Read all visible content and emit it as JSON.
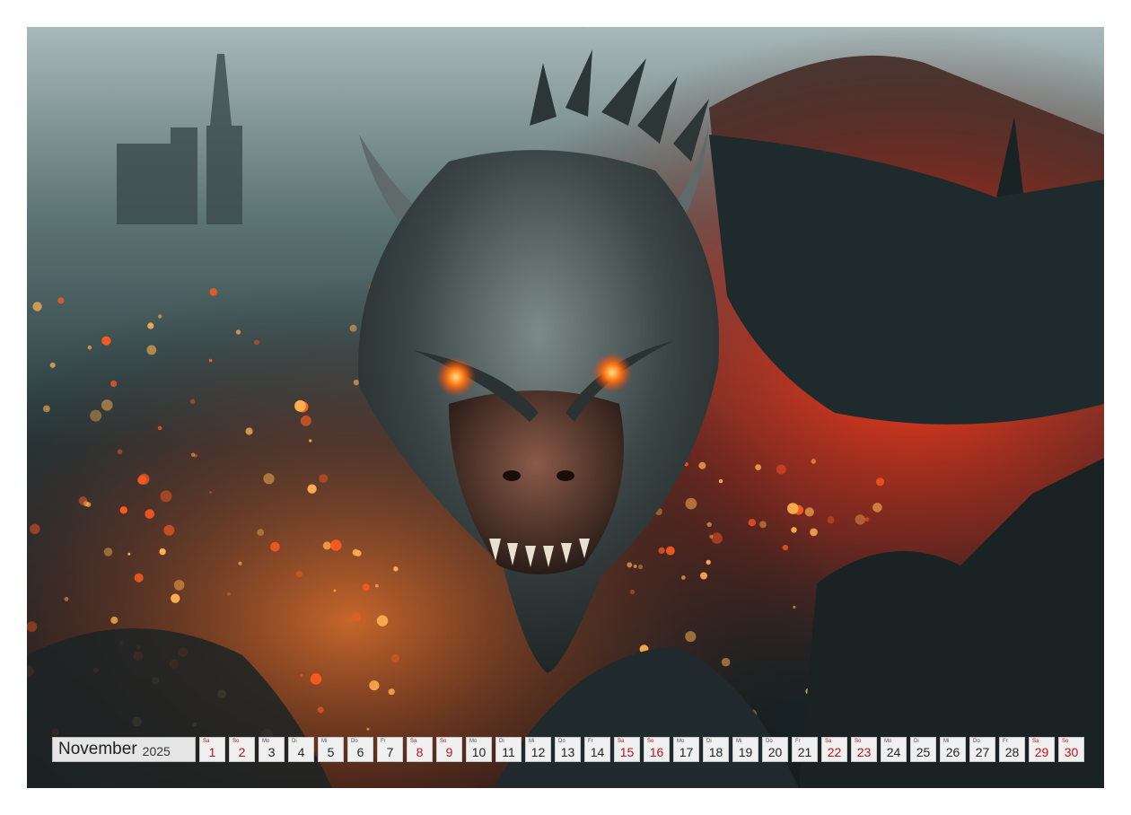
{
  "calendar": {
    "month": "November",
    "year": "2025",
    "days": [
      {
        "n": "1",
        "w": "Sa",
        "weekend": true
      },
      {
        "n": "2",
        "w": "So",
        "weekend": true
      },
      {
        "n": "3",
        "w": "Mo",
        "weekend": false
      },
      {
        "n": "4",
        "w": "Di",
        "weekend": false
      },
      {
        "n": "5",
        "w": "Mi",
        "weekend": false
      },
      {
        "n": "6",
        "w": "Do",
        "weekend": false
      },
      {
        "n": "7",
        "w": "Fr",
        "weekend": false
      },
      {
        "n": "8",
        "w": "Sa",
        "weekend": true
      },
      {
        "n": "9",
        "w": "So",
        "weekend": true
      },
      {
        "n": "10",
        "w": "Mo",
        "weekend": false
      },
      {
        "n": "11",
        "w": "Di",
        "weekend": false
      },
      {
        "n": "12",
        "w": "Mi",
        "weekend": false
      },
      {
        "n": "13",
        "w": "Do",
        "weekend": false
      },
      {
        "n": "14",
        "w": "Fr",
        "weekend": false
      },
      {
        "n": "15",
        "w": "Sa",
        "weekend": true
      },
      {
        "n": "16",
        "w": "So",
        "weekend": true
      },
      {
        "n": "17",
        "w": "Mo",
        "weekend": false
      },
      {
        "n": "18",
        "w": "Di",
        "weekend": false
      },
      {
        "n": "19",
        "w": "Mi",
        "weekend": false
      },
      {
        "n": "20",
        "w": "Do",
        "weekend": false
      },
      {
        "n": "21",
        "w": "Fr",
        "weekend": false
      },
      {
        "n": "22",
        "w": "Sa",
        "weekend": true
      },
      {
        "n": "23",
        "w": "So",
        "weekend": true
      },
      {
        "n": "24",
        "w": "Mo",
        "weekend": false
      },
      {
        "n": "25",
        "w": "Di",
        "weekend": false
      },
      {
        "n": "26",
        "w": "Mi",
        "weekend": false
      },
      {
        "n": "27",
        "w": "Do",
        "weekend": false
      },
      {
        "n": "28",
        "w": "Fr",
        "weekend": false
      },
      {
        "n": "29",
        "w": "Sa",
        "weekend": true
      },
      {
        "n": "30",
        "w": "So",
        "weekend": true
      }
    ]
  },
  "colors": {
    "weekend": "#c0141b",
    "weekday": "#222222",
    "ember": "#ff5a1f",
    "eyes": "#ff8a20"
  },
  "photo": {
    "subject": "dragon-head-over-burning-city"
  }
}
